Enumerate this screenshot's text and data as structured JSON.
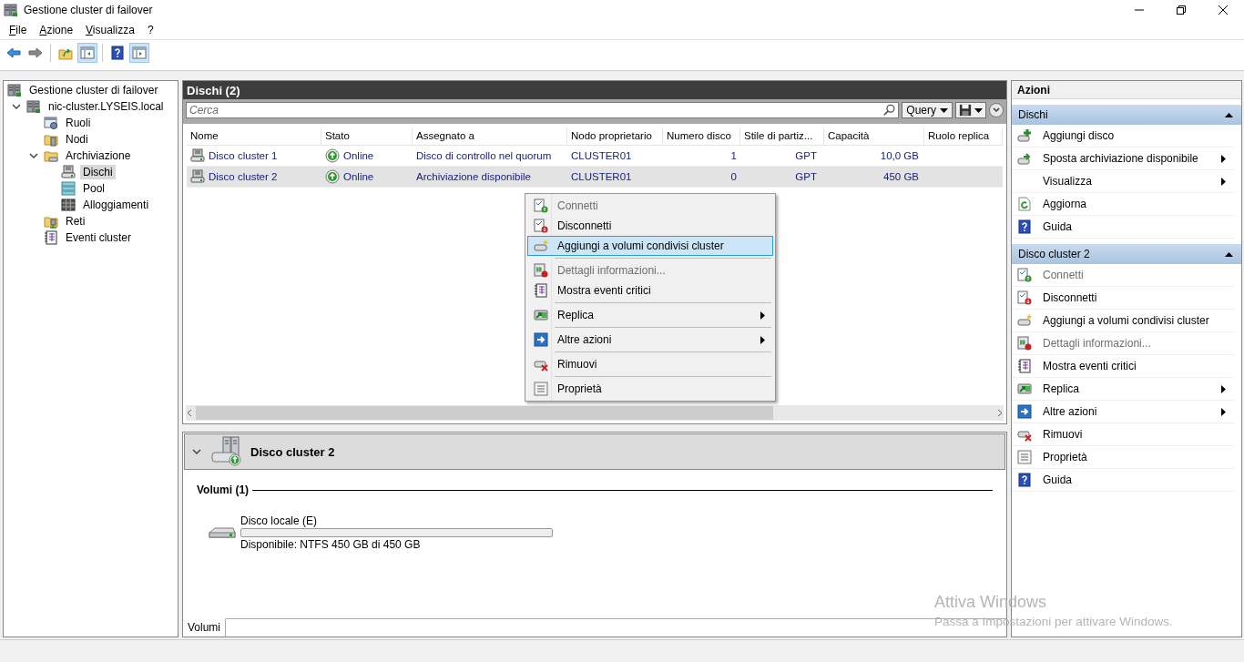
{
  "window": {
    "title": "Gestione cluster di failover"
  },
  "menu_bar": [
    "File",
    "Azione",
    "Visualizza",
    "?"
  ],
  "tree": [
    {
      "label": "Gestione cluster di failover",
      "kind": "cluster",
      "selected": false,
      "children": [
        {
          "label": "nic-cluster.LYSEIS.local",
          "kind": "cluster",
          "selected": false,
          "expanded": true,
          "children": [
            {
              "label": "Ruoli",
              "kind": "roles",
              "selected": false
            },
            {
              "label": "Nodi",
              "kind": "nodes",
              "selected": false
            },
            {
              "label": "Archiviazione",
              "kind": "storage",
              "selected": false,
              "expanded": true,
              "children": [
                {
                  "label": "Dischi",
                  "kind": "disks",
                  "selected": true
                },
                {
                  "label": "Pool",
                  "kind": "pools",
                  "selected": false
                },
                {
                  "label": "Alloggiamenti",
                  "kind": "enclosures",
                  "selected": false
                }
              ]
            },
            {
              "label": "Reti",
              "kind": "networks",
              "selected": false
            },
            {
              "label": "Eventi cluster",
              "kind": "events",
              "selected": false
            }
          ]
        }
      ]
    }
  ],
  "disks": {
    "title": "Dischi (2)",
    "search": {
      "placeholder": "Cerca"
    },
    "query_button": "Query",
    "columns": [
      "Nome",
      "Stato",
      "Assegnato a",
      "Nodo proprietario",
      "Numero disco",
      "Stile di partiz...",
      "Capacità",
      "Ruolo replica"
    ],
    "rows": [
      {
        "selected": false,
        "cells": [
          "Disco cluster 1",
          "Online",
          "Disco di controllo nel quorum",
          "CLUSTER01",
          "1",
          "GPT",
          "10,0 GB",
          null
        ]
      },
      {
        "selected": true,
        "cells": [
          "Disco cluster 2",
          "Online",
          "Archiviazione disponibile",
          "CLUSTER01",
          "0",
          "GPT",
          "450 GB",
          null
        ]
      }
    ]
  },
  "context_menu": {
    "groups": [
      [
        {
          "label": "Connetti",
          "kind": "connect",
          "disabled": true,
          "submenu": false,
          "selected": false
        },
        {
          "label": "Disconnetti",
          "kind": "disconnect",
          "disabled": false,
          "submenu": false,
          "selected": false
        },
        {
          "label": "Aggiungi a volumi condivisi cluster",
          "kind": "add-csv",
          "disabled": false,
          "submenu": false,
          "selected": true
        }
      ],
      [
        {
          "label": "Dettagli informazioni...",
          "kind": "info",
          "disabled": true,
          "submenu": false,
          "selected": false
        },
        {
          "label": "Mostra eventi critici",
          "kind": "events",
          "disabled": false,
          "submenu": false,
          "selected": false
        }
      ],
      [
        {
          "label": "Replica",
          "kind": "replica",
          "disabled": false,
          "submenu": true,
          "selected": false
        }
      ],
      [
        {
          "label": "Altre azioni",
          "kind": "more",
          "disabled": false,
          "submenu": true,
          "selected": false
        }
      ],
      [
        {
          "label": "Rimuovi",
          "kind": "remove",
          "disabled": false,
          "submenu": false,
          "selected": false
        }
      ],
      [
        {
          "label": "Proprietà",
          "kind": "properties",
          "disabled": false,
          "submenu": false,
          "selected": false
        }
      ]
    ]
  },
  "detail": {
    "title": "Disco cluster 2",
    "expanded": true,
    "section": "Volumi (1)",
    "volumes": [
      {
        "name": "Disco locale (E)",
        "level": 0,
        "info": "Disponibile: NTFS 450 GB di 450 GB"
      }
    ],
    "tabs": [
      {
        "label": "Volumi",
        "selected": true
      }
    ]
  },
  "actions": {
    "title": "Azioni",
    "sections": [
      {
        "title": "Dischi",
        "expanded": true,
        "items": [
          {
            "label": "Aggiungi disco",
            "kind": "add-disk",
            "disabled": false,
            "submenu": false
          },
          {
            "label": "Sposta archiviazione disponibile",
            "kind": "move",
            "disabled": false,
            "submenu": true
          },
          {
            "label": "Visualizza",
            "kind": "none",
            "disabled": false,
            "submenu": true
          },
          {
            "label": "Aggiorna",
            "kind": "refresh",
            "disabled": false,
            "submenu": false
          },
          {
            "label": "Guida",
            "kind": "help",
            "disabled": false,
            "submenu": false
          }
        ]
      },
      {
        "title": "Disco cluster 2",
        "expanded": true,
        "items": [
          {
            "label": "Connetti",
            "kind": "connect",
            "disabled": true,
            "submenu": false
          },
          {
            "label": "Disconnetti",
            "kind": "disconnect",
            "disabled": false,
            "submenu": false
          },
          {
            "label": "Aggiungi a volumi condivisi cluster",
            "kind": "add-csv",
            "disabled": false,
            "submenu": false
          },
          {
            "label": "Dettagli informazioni...",
            "kind": "info",
            "disabled": true,
            "submenu": false
          },
          {
            "label": "Mostra eventi critici",
            "kind": "events",
            "disabled": false,
            "submenu": false
          },
          {
            "label": "Replica",
            "kind": "replica",
            "disabled": false,
            "submenu": true
          },
          {
            "label": "Altre azioni",
            "kind": "more",
            "disabled": false,
            "submenu": true
          },
          {
            "label": "Rimuovi",
            "kind": "remove",
            "disabled": false,
            "submenu": false
          },
          {
            "label": "Proprietà",
            "kind": "properties",
            "disabled": false,
            "submenu": false
          },
          {
            "label": "Guida",
            "kind": "help",
            "disabled": false,
            "submenu": false
          }
        ]
      }
    ]
  },
  "activation_notice": {
    "title": "Attiva Windows",
    "text": "Passa a Impostazioni per attivare Windows."
  }
}
